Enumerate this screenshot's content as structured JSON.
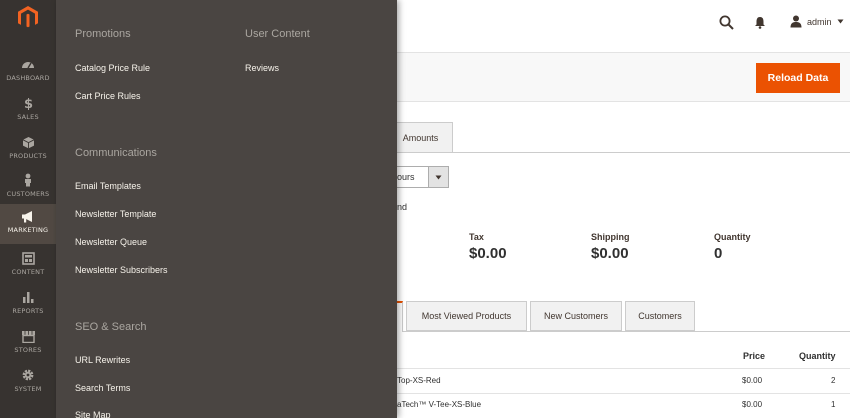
{
  "rail": {
    "items": [
      {
        "label": "DASHBOARD",
        "icon": "dashboard-icon"
      },
      {
        "label": "SALES",
        "icon": "dollar-icon"
      },
      {
        "label": "PRODUCTS",
        "icon": "cube-icon"
      },
      {
        "label": "CUSTOMERS",
        "icon": "person-icon"
      },
      {
        "label": "MARKETING",
        "icon": "megaphone-icon",
        "active": true
      },
      {
        "label": "CONTENT",
        "icon": "layout-icon"
      },
      {
        "label": "REPORTS",
        "icon": "bar-chart-icon"
      },
      {
        "label": "STORES",
        "icon": "store-icon"
      },
      {
        "label": "SYSTEM",
        "icon": "gear-icon"
      }
    ]
  },
  "flyout": {
    "promotions": {
      "title": "Promotions",
      "links": [
        "Catalog Price Rule",
        "Cart Price Rules"
      ]
    },
    "communications": {
      "title": "Communications",
      "links": [
        "Email Templates",
        "Newsletter Template",
        "Newsletter Queue",
        "Newsletter Subscribers"
      ]
    },
    "seo": {
      "title": "SEO & Search",
      "links": [
        "URL Rewrites",
        "Search Terms",
        "Site Map"
      ]
    },
    "user_content": {
      "title": "User Content",
      "links": [
        "Reviews"
      ]
    }
  },
  "header": {
    "user": "admin"
  },
  "actions": {
    "reload_label": "Reload Data"
  },
  "top_tabs": {
    "amounts": "Amounts"
  },
  "period": {
    "selected": "ours"
  },
  "partial_text": "nd",
  "stats": [
    {
      "label": "Tax",
      "value": "$0.00"
    },
    {
      "label": "Shipping",
      "value": "$0.00"
    },
    {
      "label": "Quantity",
      "value": "0"
    }
  ],
  "bottom_tabs": [
    "Most Viewed Products",
    "New Customers",
    "Customers"
  ],
  "table": {
    "headers": {
      "price": "Price",
      "quantity": "Quantity"
    },
    "rows": [
      {
        "product": "Top-XS-Red",
        "price": "$0.00",
        "quantity": "2"
      },
      {
        "product": "aTech™ V-Tee-XS-Blue",
        "price": "$0.00",
        "quantity": "1"
      }
    ]
  },
  "colors": {
    "rail": "#373330",
    "flyout": "#4a4542",
    "accent": "#eb5202"
  }
}
